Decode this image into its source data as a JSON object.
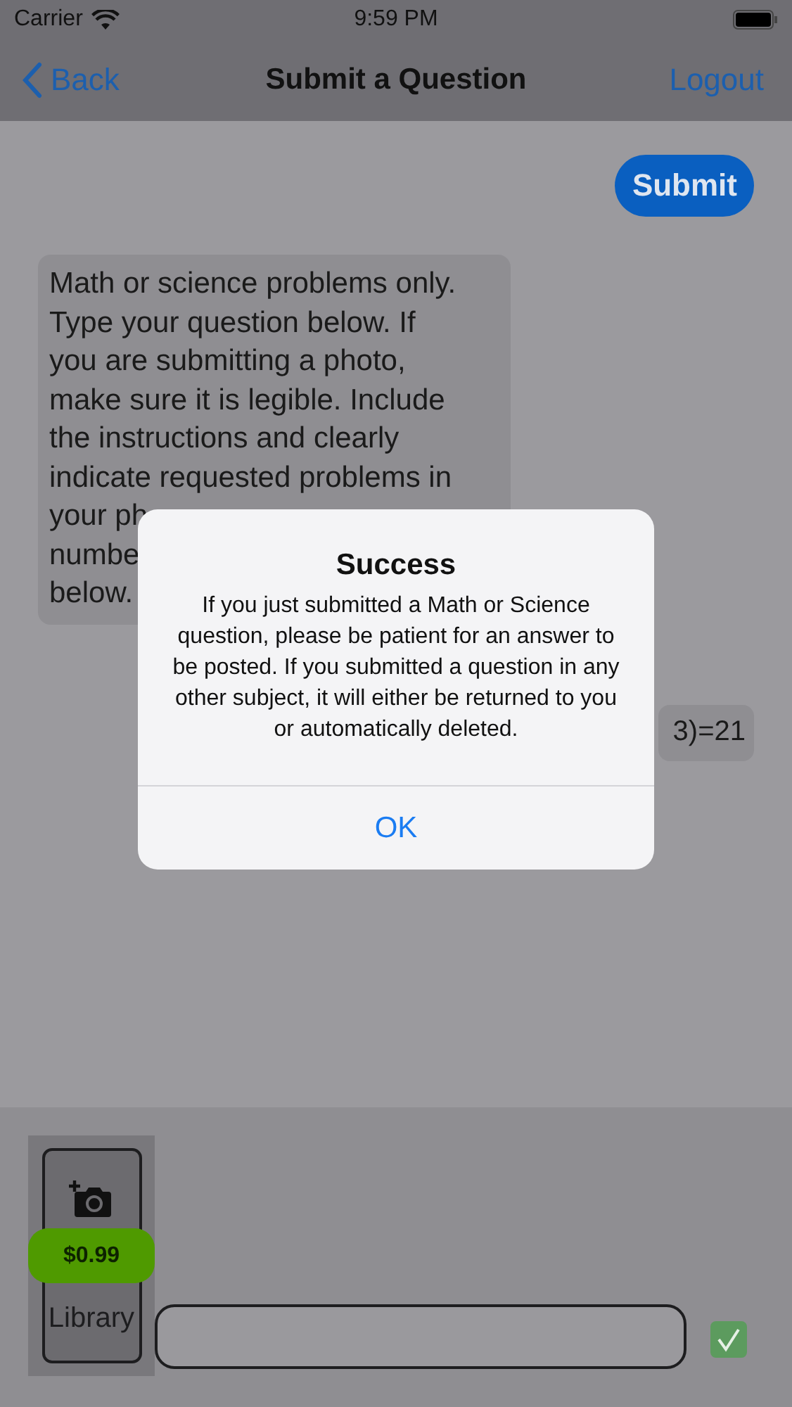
{
  "status_bar": {
    "carrier": "Carrier",
    "time": "9:59 PM"
  },
  "nav": {
    "back": "Back",
    "title": "Submit a Question",
    "action": "Logout"
  },
  "submit_button": "Submit",
  "instructions": {
    "lines": [
      "Math or science problems only.",
      "Type your question below. If",
      "you are submitting a photo,",
      "make sure it is legible. Include",
      "the instructions and clearly",
      "indicate requested problems in",
      "your ph",
      "numbe",
      "below."
    ]
  },
  "answer_preview": "3)=21",
  "alert": {
    "title": "Success",
    "message": "If you just submitted a Math or Science question, please be patient for an answer to be posted. If you submitted a question in any other subject, it will either be returned to you or automatically deleted.",
    "button": "OK"
  },
  "toolbar": {
    "library_button": {
      "price": "$0.99",
      "label": "Library"
    },
    "confirm": {
      "checked": true
    }
  }
}
